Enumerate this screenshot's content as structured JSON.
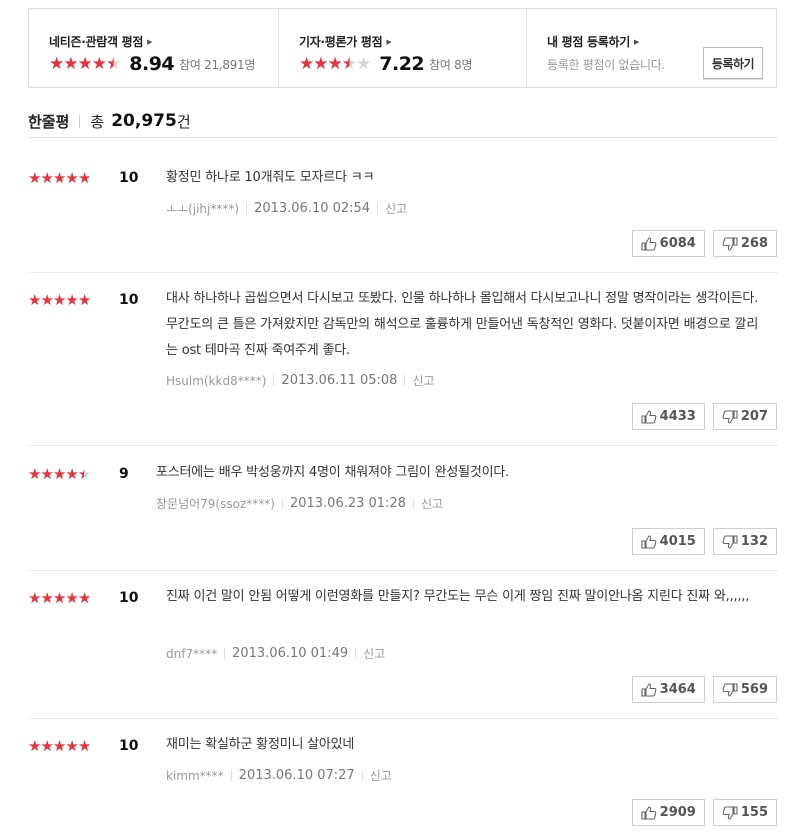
{
  "summary": {
    "audience": {
      "title": "네티즌·관람객 평점",
      "score": "8.94",
      "participants": "참여 21,891명",
      "stars": [
        1,
        1,
        1,
        1,
        0.5
      ]
    },
    "critic": {
      "title": "기자·평론가 평점",
      "score": "7.22",
      "participants": "참여 8명",
      "stars": [
        1,
        1,
        1,
        0.5,
        0
      ]
    },
    "mine": {
      "title": "내 평점 등록하기",
      "description": "등록한 평점이 없습니다.",
      "button": "등록하기"
    }
  },
  "header": {
    "label": "한줄평",
    "total_label": "총",
    "count": "20,975",
    "unit": "건"
  },
  "icons": {
    "star": "star-icon",
    "like": "thumbs-up-icon",
    "dislike": "thumbs-down-icon",
    "arrow": "chevron-right-icon"
  },
  "colors": {
    "star_filled": "#e8323f",
    "star_empty": "#d4d4d4"
  },
  "reviews": [
    {
      "score": "10",
      "stars": [
        1,
        1,
        1,
        1,
        1
      ],
      "text": "황정민 하나로 10개줘도 모자르다 ㅋㅋ",
      "author": "ㅗㅗ(jihj****)",
      "date": "2013.06.10 02:54",
      "report": "신고",
      "likes": "6084",
      "dislikes": "268"
    },
    {
      "score": "10",
      "stars": [
        1,
        1,
        1,
        1,
        1
      ],
      "text": "대사 하나하나 곱씹으면서 다시보고 또봤다. 인물 하나하나 몰입해서 다시보고나니 정말 명작이라는 생각이든다. 무간도의 큰 틀은 가져왔지만 감독만의 해석으로 훌륭하게 만들어낸 독창적인 영화다. 덧붙이자면 배경으로 깔리는 ost 테마곡 진짜 죽여주게 좋다.",
      "author": "Hsulm(kkd8****)",
      "date": "2013.06.11 05:08",
      "report": "신고",
      "likes": "4433",
      "dislikes": "207"
    },
    {
      "score": "9",
      "stars": [
        1,
        1,
        1,
        1,
        0.5
      ],
      "text": "포스터에는 배우 박성웅까지 4명이 채워져야 그림이 완성될것이다.",
      "author": "창문넘어79(ssoz****)",
      "date": "2013.06.23 01:28",
      "report": "신고",
      "likes": "4015",
      "dislikes": "132"
    },
    {
      "score": "10",
      "stars": [
        1,
        1,
        1,
        1,
        1
      ],
      "text": "진짜 이건 말이 안됨 어떻게 이런영화를 만들지? 무간도는 무슨 이게 짱임 진짜 말이안나옴 지린다 진짜 와,,,,,,",
      "author": "dnf7****",
      "date": "2013.06.10 01:49",
      "report": "신고",
      "likes": "3464",
      "dislikes": "569"
    },
    {
      "score": "10",
      "stars": [
        1,
        1,
        1,
        1,
        1
      ],
      "text": "재미는 확실하군 황정미니 살아있네",
      "author": "kimm****",
      "date": "2013.06.10 07:27",
      "report": "신고",
      "likes": "2909",
      "dislikes": "155"
    }
  ]
}
